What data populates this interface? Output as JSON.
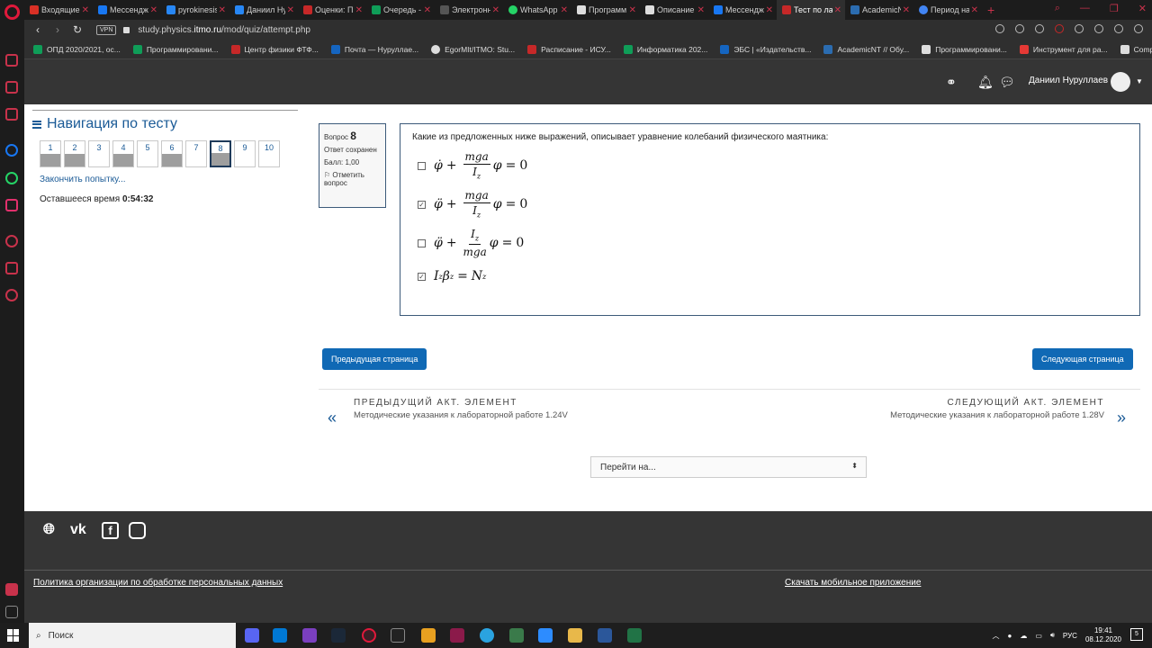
{
  "browser": {
    "tabs": [
      {
        "title": "Входящие",
        "color": "#d93025"
      },
      {
        "title": "Мессенджер",
        "color": "#1877f2"
      },
      {
        "title": "pyrokinesis",
        "color": "#2787f5"
      },
      {
        "title": "Даниил Ну",
        "color": "#2787f5"
      },
      {
        "title": "Оценки: Пр",
        "color": "#c62828"
      },
      {
        "title": "Очередь -",
        "color": "#0f9d58"
      },
      {
        "title": "Электронн",
        "color": "#555"
      },
      {
        "title": "WhatsApp",
        "color": "#25d366"
      },
      {
        "title": "Программ",
        "color": "#ddd"
      },
      {
        "title": "Описание",
        "color": "#ddd"
      },
      {
        "title": "Мессендж",
        "color": "#1877f2"
      },
      {
        "title": "Тест по лаб",
        "color": "#c62828"
      },
      {
        "title": "AcademicN",
        "color": "#2b6cb0"
      },
      {
        "title": "Период на",
        "color": "#4285f4"
      }
    ],
    "url_prefix": "study.physics.",
    "url_host": "itmo.ru",
    "url_path": "/mod/quiz/attempt.php",
    "vpn_label": "VPN",
    "bookmarks": [
      {
        "label": "ОПД 2020/2021, ос...",
        "color": "#0f9d58"
      },
      {
        "label": "Программировани...",
        "color": "#0f9d58"
      },
      {
        "label": "Центр физики ФТФ...",
        "color": "#c62828"
      },
      {
        "label": "Почта — Нуруллае...",
        "color": "#1565c0"
      },
      {
        "label": "EgorMIt/ITMO: Stu...",
        "color": "#ddd"
      },
      {
        "label": "Расписание - ИСУ...",
        "color": "#c62828"
      },
      {
        "label": "Информатика 202...",
        "color": "#0f9d58"
      },
      {
        "label": "ЭБС | «Издательств...",
        "color": "#1565c0"
      },
      {
        "label": "AcademicNT // Обу...",
        "color": "#2b6cb0"
      },
      {
        "label": "Программировани...",
        "color": "#ddd"
      },
      {
        "label": "Инструмент для ра...",
        "color": "#e53935"
      },
      {
        "label": "Compiled",
        "color": "#ddd"
      }
    ]
  },
  "moodle_nav": {
    "user_name": "Даниил Нуруллаев"
  },
  "quiz_nav": {
    "title": "Навигация по тесту",
    "questions": [
      {
        "n": "1",
        "state": "answered"
      },
      {
        "n": "2",
        "state": "answered"
      },
      {
        "n": "3",
        "state": "empty"
      },
      {
        "n": "4",
        "state": "answered"
      },
      {
        "n": "5",
        "state": "empty"
      },
      {
        "n": "6",
        "state": "answered"
      },
      {
        "n": "7",
        "state": "empty"
      },
      {
        "n": "8",
        "state": "current"
      },
      {
        "n": "9",
        "state": "empty"
      },
      {
        "n": "10",
        "state": "empty"
      }
    ],
    "finish_link": "Закончить попытку...",
    "time_label": "Оставшееся время",
    "time_value": "0:54:32"
  },
  "question_info": {
    "label": "Вопрос",
    "number": "8",
    "status": "Ответ сохранен",
    "score": "Балл: 1,00",
    "flag": "Отметить вопрос"
  },
  "question": {
    "text": "Какие из предложенных ниже выражений, описывает уравнение колебаний физического маятника:",
    "options": [
      {
        "checked": false
      },
      {
        "checked": true
      },
      {
        "checked": false
      },
      {
        "checked": true
      }
    ]
  },
  "buttons": {
    "prev_page": "Предыдущая страница",
    "next_page": "Следующая страница"
  },
  "activity_nav": {
    "prev_label": "ПРЕДЫДУЩИЙ АКТ. ЭЛЕМЕНТ",
    "prev_name": "Методические указания к лабораторной работе 1.24V",
    "next_label": "СЛЕДУЮЩИЙ АКТ. ЭЛЕМЕНТ",
    "next_name": "Методические указания к лабораторной работе 1.28V",
    "jump_placeholder": "Перейти на..."
  },
  "footer": {
    "privacy_link": "Политика организации по обработке персональных данных",
    "mobile_link": "Скачать мобильное приложение"
  },
  "taskbar": {
    "search_placeholder": "Поиск",
    "lang": "РУС",
    "time": "19:41",
    "date": "08.12.2020",
    "notifications": "5"
  }
}
